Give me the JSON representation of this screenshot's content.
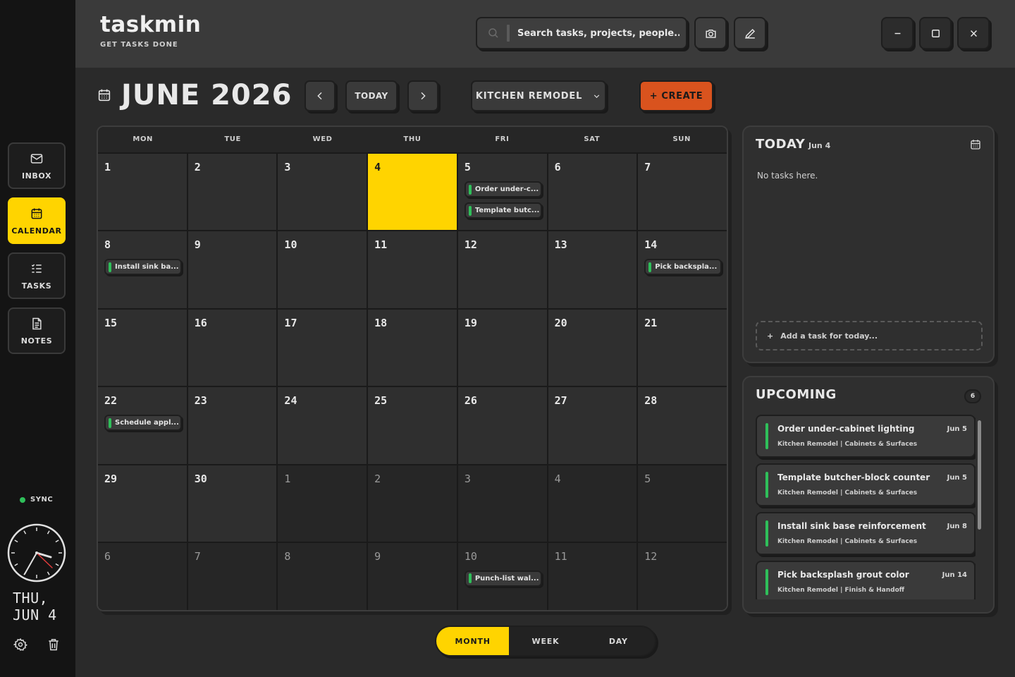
{
  "app": {
    "name": "taskmin",
    "tagline": "GET TASKS DONE"
  },
  "search": {
    "placeholder": "Search tasks, projects, people..."
  },
  "nav": [
    {
      "id": "inbox",
      "label": "INBOX",
      "icon": "mail-icon"
    },
    {
      "id": "calendar",
      "label": "CALENDAR",
      "icon": "calendar-icon",
      "active": true
    },
    {
      "id": "tasks",
      "label": "TASKS",
      "icon": "checklist-icon"
    },
    {
      "id": "notes",
      "label": "NOTES",
      "icon": "document-icon"
    }
  ],
  "status": {
    "sync": "SYNC",
    "sync_color": "#2fbf5a"
  },
  "clock": {
    "day": "THU,",
    "date": "JUN 4"
  },
  "header": {
    "month_title": "JUNE 2026",
    "today_btn": "TODAY",
    "project": "KITCHEN REMODEL",
    "create_btn": "+ CREATE"
  },
  "calendar": {
    "weekdays": [
      "MON",
      "TUE",
      "WED",
      "THU",
      "FRI",
      "SAT",
      "SUN"
    ],
    "cells": [
      {
        "day": "1"
      },
      {
        "day": "2"
      },
      {
        "day": "3"
      },
      {
        "day": "4",
        "today": true
      },
      {
        "day": "5",
        "events": [
          "Order under-c...",
          "Template butc..."
        ]
      },
      {
        "day": "6"
      },
      {
        "day": "7"
      },
      {
        "day": "8",
        "events": [
          "Install sink ba..."
        ]
      },
      {
        "day": "9"
      },
      {
        "day": "10"
      },
      {
        "day": "11"
      },
      {
        "day": "12"
      },
      {
        "day": "13"
      },
      {
        "day": "14",
        "events": [
          "Pick backspla..."
        ]
      },
      {
        "day": "15"
      },
      {
        "day": "16"
      },
      {
        "day": "17"
      },
      {
        "day": "18"
      },
      {
        "day": "19"
      },
      {
        "day": "20"
      },
      {
        "day": "21"
      },
      {
        "day": "22",
        "events": [
          "Schedule appl..."
        ]
      },
      {
        "day": "23"
      },
      {
        "day": "24"
      },
      {
        "day": "25"
      },
      {
        "day": "26"
      },
      {
        "day": "27"
      },
      {
        "day": "28"
      },
      {
        "day": "29"
      },
      {
        "day": "30"
      },
      {
        "day": "1",
        "other": true
      },
      {
        "day": "2",
        "other": true
      },
      {
        "day": "3",
        "other": true
      },
      {
        "day": "4",
        "other": true
      },
      {
        "day": "5",
        "other": true
      },
      {
        "day": "6",
        "other": true
      },
      {
        "day": "7",
        "other": true
      },
      {
        "day": "8",
        "other": true
      },
      {
        "day": "9",
        "other": true
      },
      {
        "day": "10",
        "other": true,
        "events": [
          "Punch-list wal..."
        ]
      },
      {
        "day": "11",
        "other": true
      },
      {
        "day": "12",
        "other": true
      }
    ]
  },
  "views": [
    {
      "label": "MONTH",
      "active": true
    },
    {
      "label": "WEEK"
    },
    {
      "label": "DAY"
    }
  ],
  "today_panel": {
    "title": "TODAY",
    "date": "Jun 4",
    "empty": "No tasks here.",
    "add": "Add a task for today..."
  },
  "upcoming": {
    "title": "UPCOMING",
    "count": "6",
    "items": [
      {
        "title": "Order under-cabinet lighting",
        "date": "Jun 5",
        "sub": "Kitchen Remodel | Cabinets & Surfaces"
      },
      {
        "title": "Template butcher-block counter",
        "date": "Jun 5",
        "sub": "Kitchen Remodel | Cabinets & Surfaces"
      },
      {
        "title": "Install sink base reinforcement",
        "date": "Jun 8",
        "sub": "Kitchen Remodel | Cabinets & Surfaces"
      },
      {
        "title": "Pick backsplash grout color",
        "date": "Jun 14",
        "sub": "Kitchen Remodel | Finish & Handoff"
      }
    ]
  },
  "colors": {
    "accent": "#ffd400",
    "create": "#d9531e",
    "event": "#2fbf5a"
  }
}
